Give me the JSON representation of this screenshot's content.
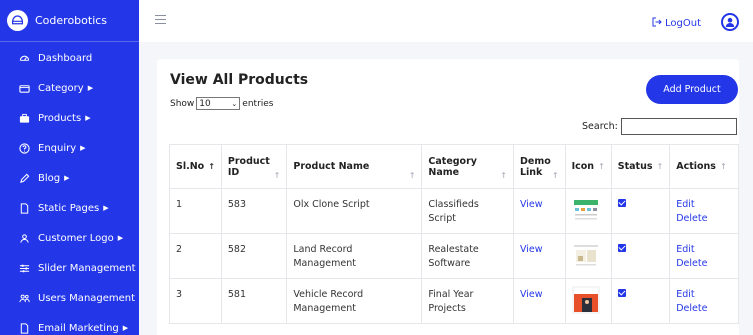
{
  "brand": {
    "name": "Coderobotics",
    "logo_icon": "helmet-icon"
  },
  "sidebar": {
    "items": [
      {
        "label": "Dashboard",
        "icon": "dashboard-icon",
        "has_caret": false
      },
      {
        "label": "Category",
        "icon": "folder-icon",
        "has_caret": true
      },
      {
        "label": "Products",
        "icon": "briefcase-icon",
        "has_caret": true
      },
      {
        "label": "Enquiry",
        "icon": "question-icon",
        "has_caret": true
      },
      {
        "label": "Blog",
        "icon": "pen-icon",
        "has_caret": true
      },
      {
        "label": "Static Pages",
        "icon": "page-icon",
        "has_caret": true
      },
      {
        "label": "Customer Logo",
        "icon": "user-icon",
        "has_caret": true
      },
      {
        "label": "Slider Management",
        "icon": "sliders-icon",
        "has_caret": false
      },
      {
        "label": "Users Management",
        "icon": "users-icon",
        "has_caret": false
      },
      {
        "label": "Email Marketing",
        "icon": "mail-icon",
        "has_caret": true
      }
    ],
    "caret": "▶"
  },
  "topbar": {
    "logout_label": "LogOut"
  },
  "main": {
    "title": "View All Products",
    "add_button": "Add Product",
    "show_label": "Show",
    "entries_value": "10",
    "entries_label": "entries",
    "search_label": "Search:",
    "search_value": ""
  },
  "table": {
    "headers": {
      "slno": "Sl.No",
      "product_id_1": "Product",
      "product_id_2": "ID",
      "product_name": "Product Name",
      "category_1": "Category",
      "category_2": "Name",
      "demo_1": "Demo",
      "demo_2": "Link",
      "icon": "Icon",
      "status": "Status",
      "actions": "Actions"
    },
    "sort_up": "↑",
    "rows": [
      {
        "slno": "1",
        "id": "583",
        "name_1": "Olx Clone Script",
        "name_2": "",
        "cat_1": "Classifieds Script",
        "cat_2": "",
        "demo": "View",
        "status": true,
        "edit": "Edit",
        "delete": "Delete"
      },
      {
        "slno": "2",
        "id": "582",
        "name_1": "Land Record Management",
        "name_2": "",
        "cat_1": "Realestate",
        "cat_2": "Software",
        "demo": "View",
        "status": true,
        "edit": "Edit",
        "delete": "Delete"
      },
      {
        "slno": "3",
        "id": "581",
        "name_1": "Vehicle Record",
        "name_2": "Management",
        "cat_1": "Final Year",
        "cat_2": "Projects",
        "demo": "View",
        "status": true,
        "edit": "Edit",
        "delete": "Delete"
      }
    ]
  },
  "colors": {
    "primary": "#2437e8",
    "background": "#f4f6f9"
  }
}
